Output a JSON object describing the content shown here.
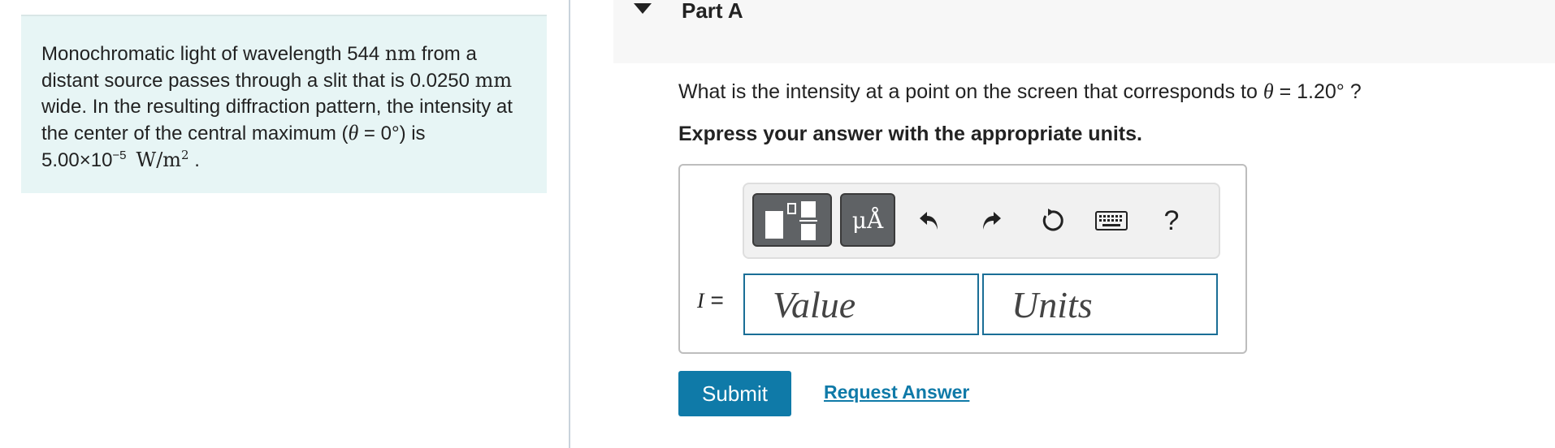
{
  "problem": {
    "p1": "Monochromatic light of wavelength 544 ",
    "nm": "nm",
    "p2": " from a distant source passes through a slit that is 0.0250 ",
    "mm": "mm",
    "p3": " wide. In the resulting diffraction pattern, the intensity at the center of the central maximum (",
    "theta": "θ",
    "p4": " = 0°) is 5.00×10",
    "exp": "−5",
    "unit": "W/m",
    "unit_exp": "2",
    "p5": " ."
  },
  "part": {
    "title": "Part A",
    "question_pre": "What is the intensity at a point on the screen that corresponds to ",
    "theta": "θ",
    "question_post": " = 1.20° ?",
    "instruction": "Express your answer with the appropriate units."
  },
  "toolbar": {
    "units_label": "μÅ",
    "help_label": "?"
  },
  "answer": {
    "variable": "I",
    "equals": " =",
    "value_placeholder": "Value",
    "units_placeholder": "Units"
  },
  "actions": {
    "submit": "Submit",
    "request": "Request Answer"
  }
}
